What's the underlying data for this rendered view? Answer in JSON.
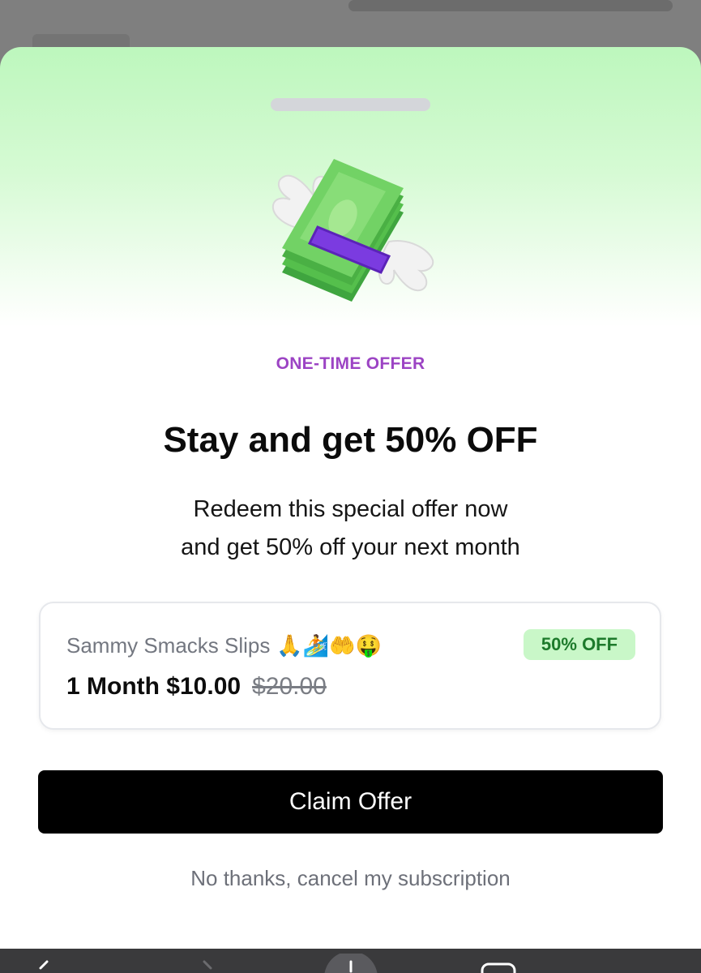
{
  "sheet": {
    "kicker": "ONE-TIME OFFER",
    "headline": "Stay and get 50% OFF",
    "subtext_line1": "Redeem this special offer now",
    "subtext_line2": "and get 50% off your next month",
    "illustration": "money-with-wings-icon"
  },
  "plan": {
    "name": "Sammy Smacks Slips",
    "emoji": "🙏🏄🤲🤑",
    "badge": "50% OFF",
    "price_new": "1 Month $10.00",
    "price_old": "$20.00"
  },
  "actions": {
    "claim_label": "Claim Offer",
    "cancel_label": "No thanks, cancel my subscription"
  },
  "colors": {
    "accent_purple": "#9c44c4",
    "badge_green_bg": "#c9f7c8",
    "badge_green_text": "#1d7a2b",
    "button_bg": "#000000",
    "header_gradient_top": "#bdf7bd"
  },
  "bottom_nav": {
    "icons": [
      "back-arrow-icon",
      "forward-arrow-icon",
      "new-tab-icon",
      "tabs-icon"
    ]
  }
}
